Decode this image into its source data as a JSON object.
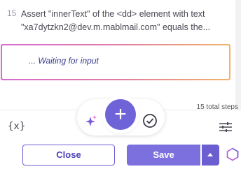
{
  "step": {
    "number": "15",
    "line1": "Assert \"innerText\" of the <dd> element with text",
    "line2": "\"xa7dytzkn2@dev.m.mablmail.com\" equals the..."
  },
  "input": {
    "placeholder": "... Waiting for input"
  },
  "total_steps": "15 total steps",
  "toolbar": {
    "variables_label": "{x}",
    "icons": [
      "variables-icon",
      "sparkle-icon",
      "plus-icon",
      "check-circle-icon",
      "sliders-icon"
    ]
  },
  "actions": {
    "close_label": "Close",
    "save_label": "Save"
  },
  "colors": {
    "accent": "#6f63d8",
    "save": "#7c70de",
    "gradient_start": "#d86ad1",
    "gradient_end": "#f1b56a"
  }
}
